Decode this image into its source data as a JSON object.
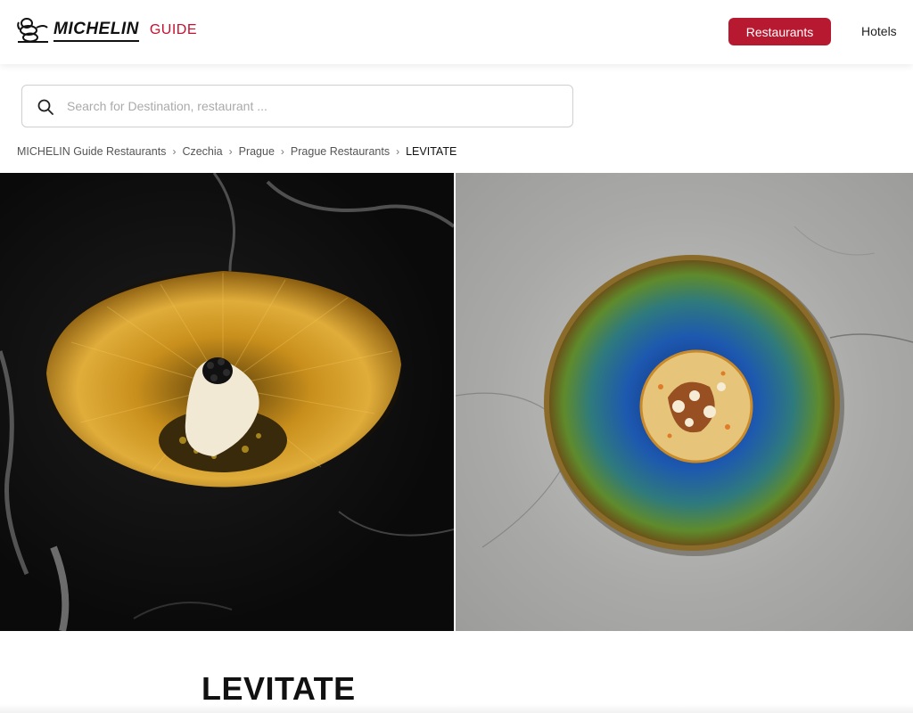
{
  "header": {
    "logo_text": "MICHELIN",
    "logo_suffix": "GUIDE",
    "nav": {
      "restaurants_label": "Restaurants",
      "hotels_label": "Hotels"
    }
  },
  "search": {
    "placeholder": "Search for Destination, restaurant ...",
    "value": "",
    "icon": "search-icon"
  },
  "breadcrumb": {
    "items": [
      "MICHELIN Guide Restaurants",
      "Czechia",
      "Prague",
      "Prague Restaurants",
      "LEVITATE"
    ],
    "separator": "›"
  },
  "gallery": {
    "photos": [
      {
        "name": "dessert-golden-bowl-photo"
      },
      {
        "name": "dish-blue-plate-photo"
      }
    ]
  },
  "restaurant": {
    "name": "LEVITATE"
  },
  "colors": {
    "brand_red": "#b71a30",
    "guide_red": "#c8102e"
  }
}
